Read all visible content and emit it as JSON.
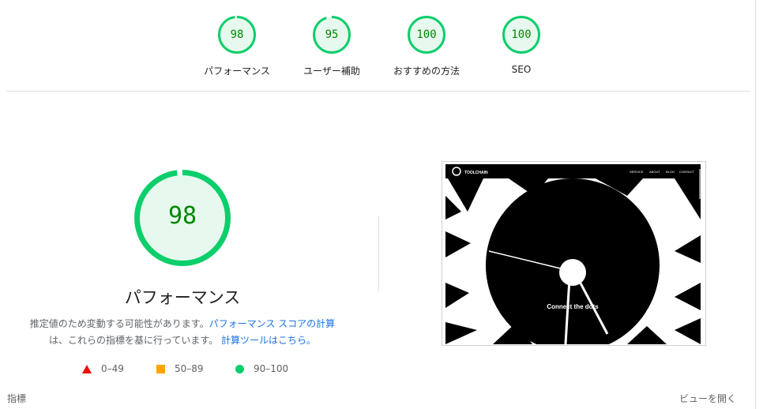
{
  "categories": [
    {
      "score": "98",
      "value": 98,
      "label": "パフォーマンス"
    },
    {
      "score": "95",
      "value": 95,
      "label": "ユーザー補助"
    },
    {
      "score": "100",
      "value": 100,
      "label": "おすすめの方法"
    },
    {
      "score": "100",
      "value": 100,
      "label": "SEO"
    }
  ],
  "main": {
    "score": "98",
    "value": 98,
    "title": "パフォーマンス",
    "desc_text_1": "推定値のため変動する可能性があります。",
    "desc_link_1": "パフォーマンス スコアの計算",
    "desc_text_2": "は、これらの指標を基に行っています。",
    "desc_link_2": "計算ツールはこちら。"
  },
  "legend": {
    "fail": "0–49",
    "average": "50–89",
    "pass": "90–100"
  },
  "colors": {
    "pass": "#0cce6b",
    "pass_bg": "#e7f9ee",
    "pass_text": "#008800",
    "average": "#ffa400",
    "fail": "#eb0f00",
    "link": "#1a73e8"
  },
  "screenshot": {
    "brand": "TOOLCHAIN",
    "nav": [
      "SERVICE",
      "ABOUT",
      "BLOG",
      "CONTACT"
    ],
    "headline": "Connect the dots"
  },
  "footer": {
    "metrics_label": "指標",
    "expand_label": "ビューを開く"
  }
}
